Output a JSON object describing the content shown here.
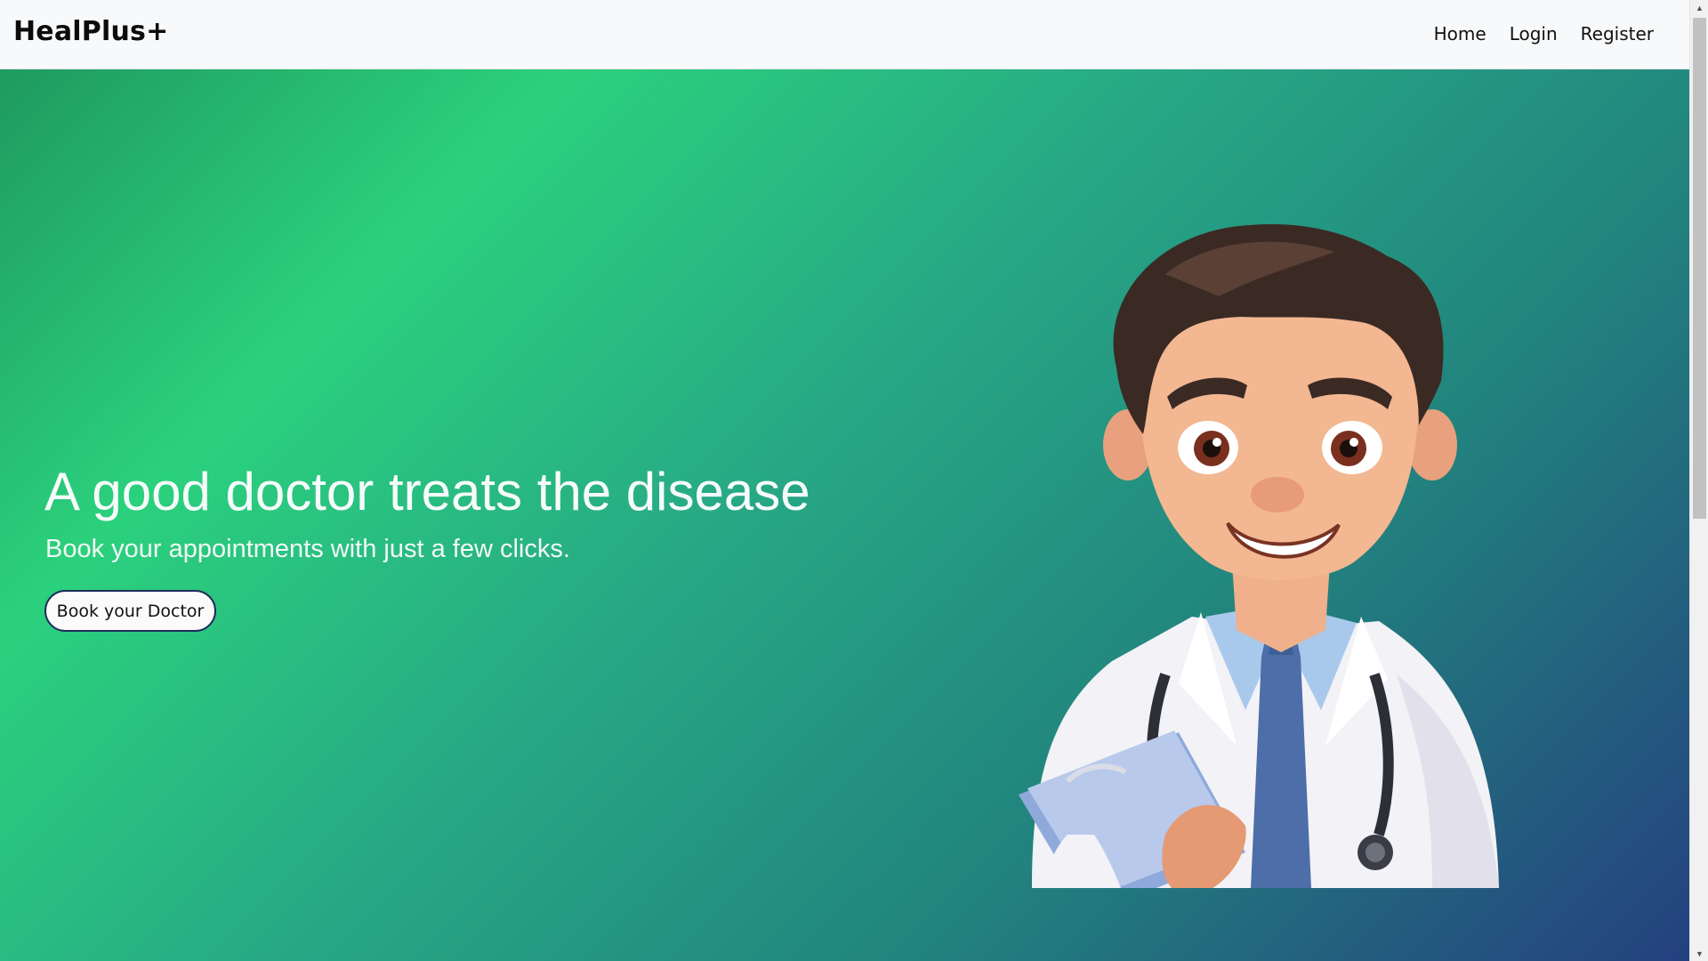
{
  "navbar": {
    "brand": "HealPlus+",
    "links": [
      {
        "label": "Home"
      },
      {
        "label": "Login"
      },
      {
        "label": "Register"
      }
    ]
  },
  "hero": {
    "title": "A good doctor treats the disease",
    "subtitle": "Book your appointments with just a few clicks.",
    "cta_label": "Book your Doctor",
    "illustration": "doctor-cartoon-illustration"
  },
  "colors": {
    "gradient_start": "#2bd17d",
    "gradient_end": "#24407f",
    "navbar_bg": "#f8f9fa",
    "button_border": "#1e2c5a"
  },
  "scrollbar": {
    "scroll_fraction": 0
  }
}
